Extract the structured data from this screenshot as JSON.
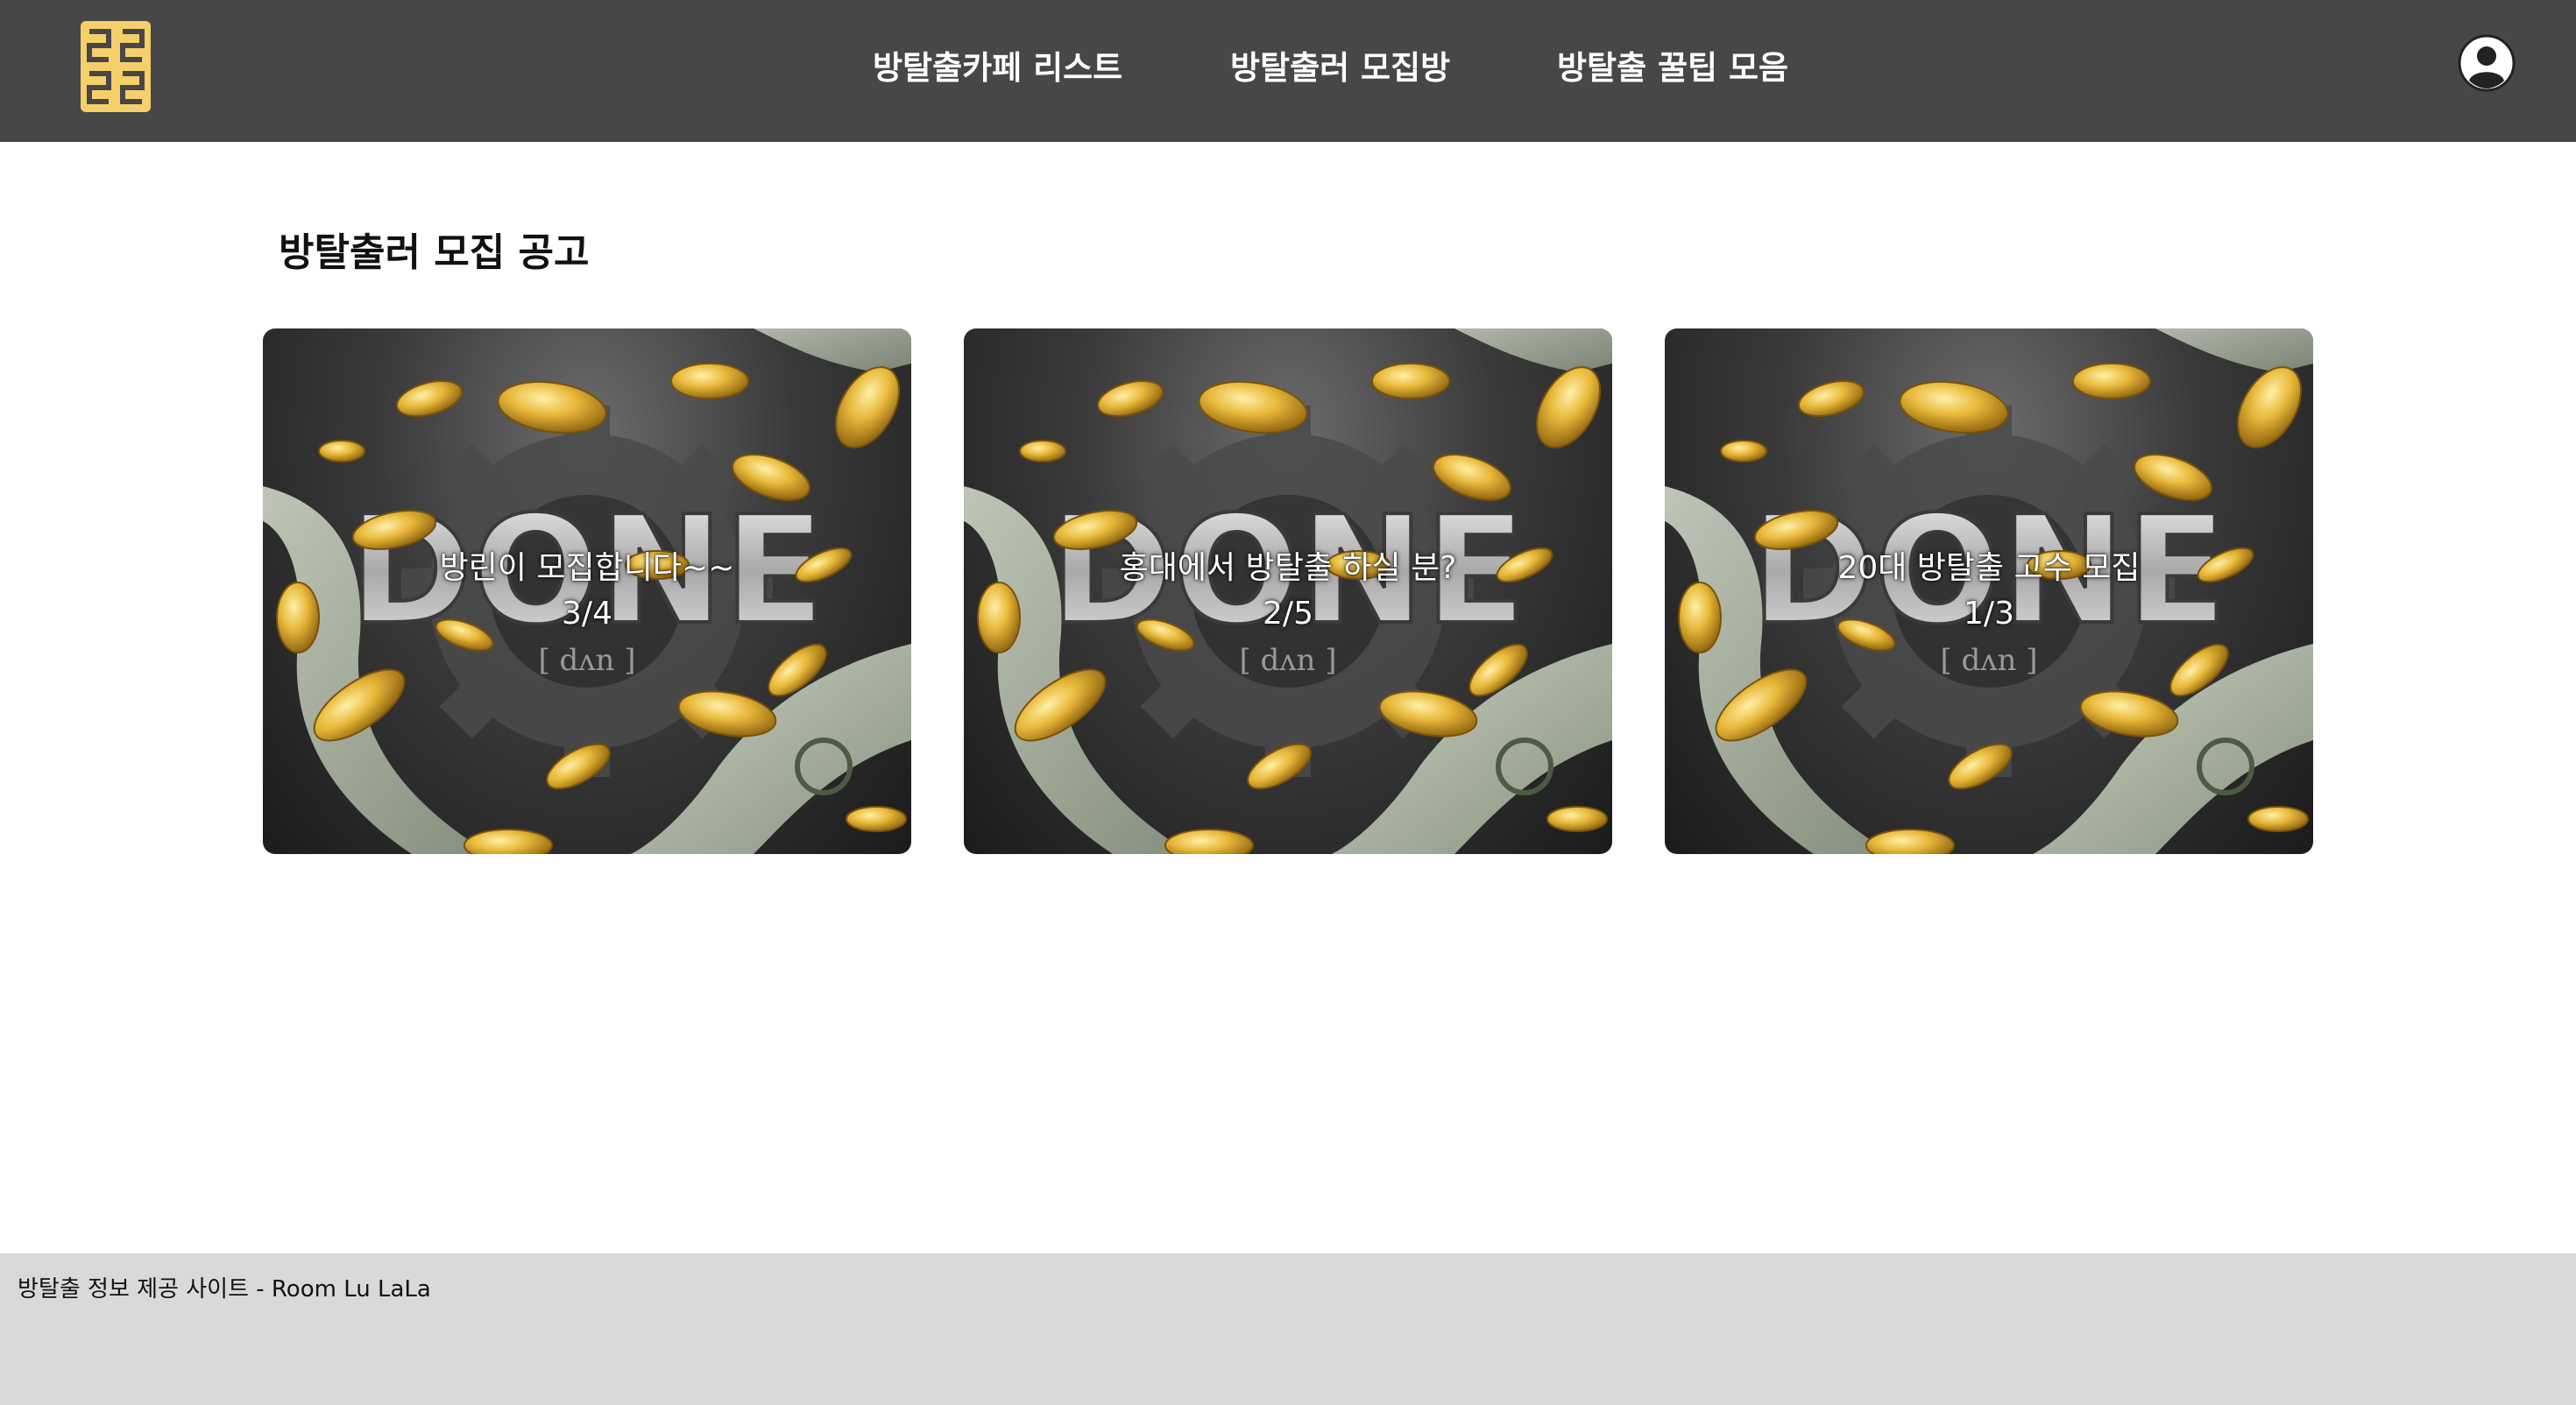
{
  "header": {
    "logo_icon": "room-lulala-logo",
    "nav": [
      {
        "label": "방탈출카페 리스트"
      },
      {
        "label": "방탈출러 모집방"
      },
      {
        "label": "방탈출 꿀팁 모음"
      }
    ],
    "profile_icon": "user-circle-icon",
    "colors": {
      "background": "#474747",
      "logo": "#f5cf6a",
      "text": "#ffffff"
    }
  },
  "main": {
    "title": "방탈출러 모집 공고",
    "cards": [
      {
        "title": "방린이 모집합니다~~",
        "count": "3/4",
        "image_text": "DONE",
        "pronunciation": "[ dʌn ]"
      },
      {
        "title": "홍대에서 방탈출 하실 분?",
        "count": "2/5",
        "image_text": "DONE",
        "pronunciation": "[ dʌn ]"
      },
      {
        "title": "20대 방탈출 고수 모집",
        "count": "1/3",
        "image_text": "DONE",
        "pronunciation": "[ dʌn ]"
      }
    ]
  },
  "footer": {
    "text": "방탈출 정보 제공 사이트 - Room Lu LaLa",
    "background": "#d9d9d9"
  }
}
